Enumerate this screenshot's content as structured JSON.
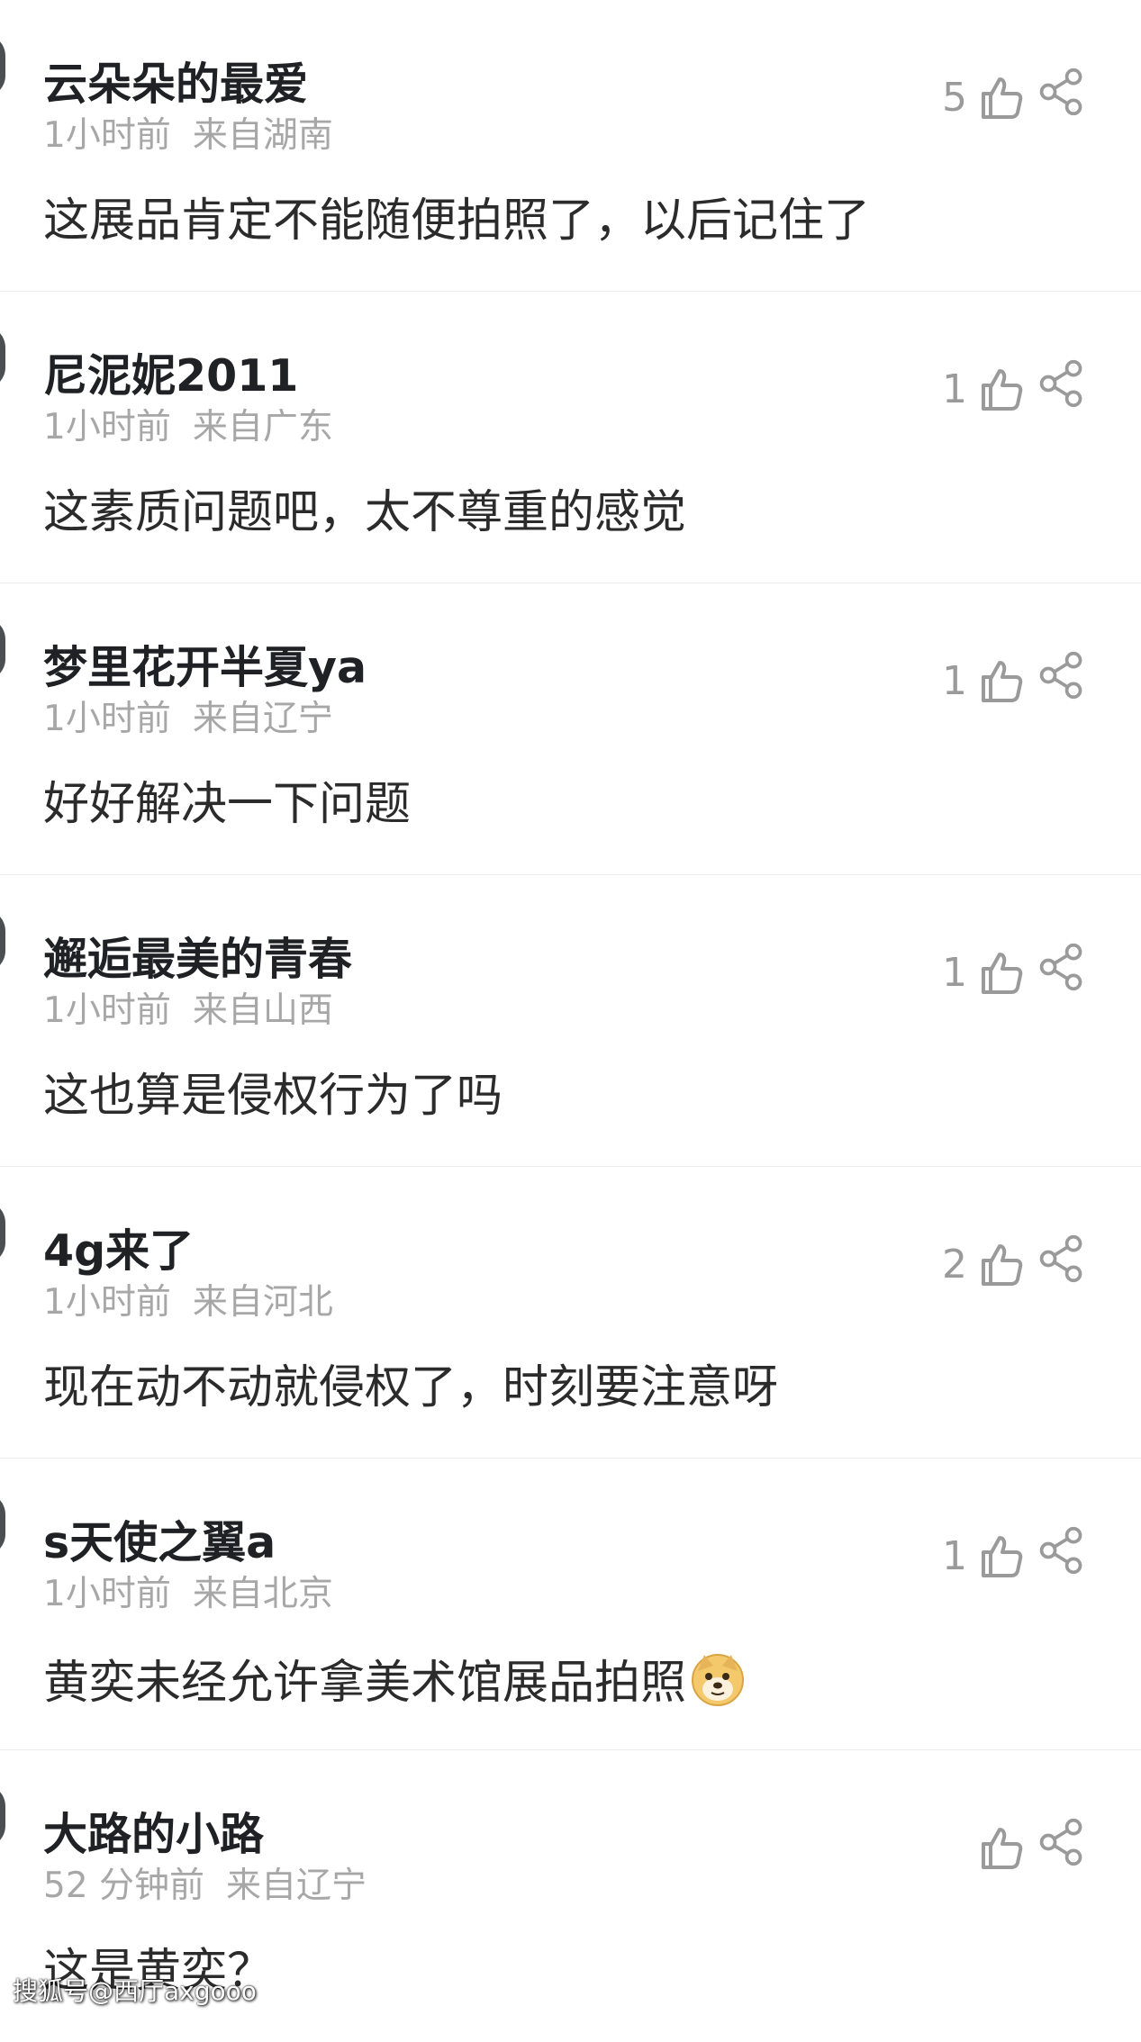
{
  "comments": [
    {
      "username": "云朵朵的最爱",
      "time": "1小时前",
      "location": "来自湖南",
      "text": "这展品肯定不能随便拍照了，以后记住了",
      "likes": "5",
      "emoji": ""
    },
    {
      "username": "尼泥妮2011",
      "time": "1小时前",
      "location": "来自广东",
      "text": "这素质问题吧，太不尊重的感觉",
      "likes": "1",
      "emoji": ""
    },
    {
      "username": "梦里花开半夏ya",
      "time": "1小时前",
      "location": "来自辽宁",
      "text": "好好解决一下问题",
      "likes": "1",
      "emoji": ""
    },
    {
      "username": "邂逅最美的青春",
      "time": "1小时前",
      "location": "来自山西",
      "text": "这也算是侵权行为了吗",
      "likes": "1",
      "emoji": ""
    },
    {
      "username": "4g来了",
      "time": "1小时前",
      "location": "来自河北",
      "text": "现在动不动就侵权了，时刻要注意呀",
      "likes": "2",
      "emoji": ""
    },
    {
      "username": "s天使之翼a",
      "time": "1小时前",
      "location": "来自北京",
      "text": "黄奕未经允许拿美术馆展品拍照",
      "likes": "1",
      "emoji": "doge-emoji"
    },
    {
      "username": "大路的小路",
      "time": "52 分钟前",
      "location": "来自辽宁",
      "text": "这是黄奕？",
      "likes": "",
      "emoji": ""
    }
  ],
  "icons": {
    "like": "thumbs-up-icon",
    "share": "share-icon"
  },
  "colors": {
    "username": "#202124",
    "meta": "#a7a7a7",
    "content": "#2b2b2b",
    "icon": "#9a9a9a",
    "divider": "#ececec"
  },
  "watermark": "搜狐号@西厅axgooo"
}
